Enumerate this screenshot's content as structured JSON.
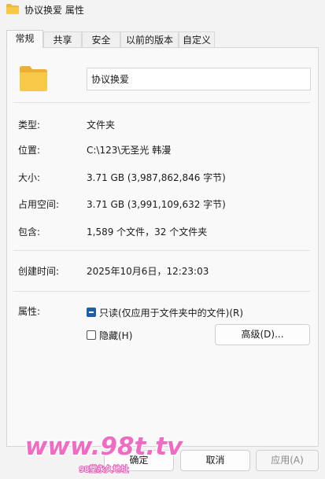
{
  "window": {
    "title": "协议换爱 属性"
  },
  "tabs": [
    {
      "label": "常规"
    },
    {
      "label": "共享"
    },
    {
      "label": "安全"
    },
    {
      "label": "以前的版本"
    },
    {
      "label": "自定义"
    }
  ],
  "general": {
    "name_value": "协议换爱",
    "type_label": "类型:",
    "type_value": "文件夹",
    "location_label": "位置:",
    "location_value": "C:\\123\\无圣光 韩漫",
    "size_label": "大小:",
    "size_value": "3.71 GB (3,987,862,846 字节)",
    "size_on_disk_label": "占用空间:",
    "size_on_disk_value": "3.71 GB (3,991,109,632 字节)",
    "contains_label": "包含:",
    "contains_value": "1,589 个文件，32 个文件夹",
    "created_label": "创建时间:",
    "created_value": "2025年10月6日，12:23:03",
    "attributes_label": "属性:",
    "readonly_label": "只读(仅应用于文件夹中的文件)(R)",
    "readonly_checked": true,
    "hidden_label": "隐藏(H)",
    "hidden_checked": false,
    "advanced_button": "高级(D)..."
  },
  "footer": {
    "ok_button": "确定",
    "cancel_button": "取消",
    "apply_button": "应用(A)"
  },
  "watermark": {
    "text": "www.98t.tv",
    "subtext": "98堂永久地址"
  },
  "colors": {
    "accent": "#1f5ea8",
    "folder_yellow": "#f8c948",
    "watermark_pink": "#f06bc4"
  }
}
